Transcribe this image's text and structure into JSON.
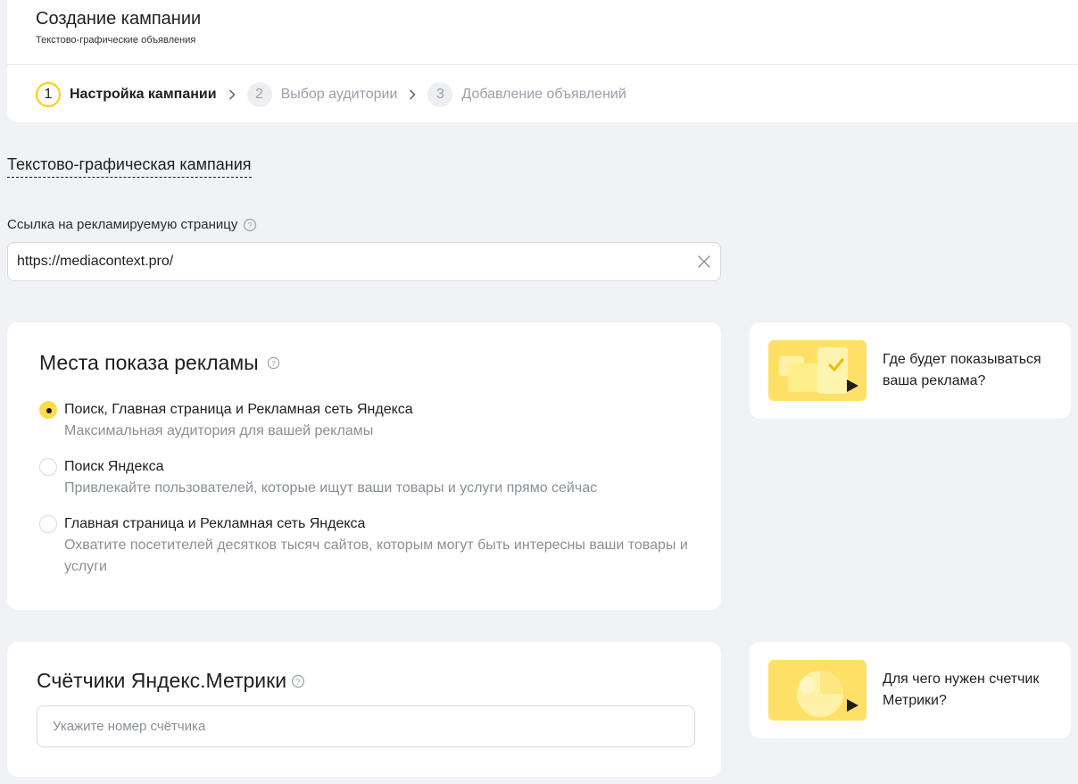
{
  "header": {
    "title": "Создание кампании",
    "subtitle": "Текстово-графические объявления"
  },
  "steps": [
    {
      "number": "1",
      "label": "Настройка кампании",
      "active": true
    },
    {
      "number": "2",
      "label": "Выбор аудитории",
      "active": false
    },
    {
      "number": "3",
      "label": "Добавление объявлений",
      "active": false
    }
  ],
  "campaign_type": "Текстово-графическая кампания",
  "url_field": {
    "label": "Ссылка на рекламируемую страницу",
    "value": "https://mediacontext.pro/"
  },
  "placements": {
    "title": "Места показа рекламы",
    "options": [
      {
        "title": "Поиск, Главная страница и Рекламная сеть Яндекса",
        "description": "Максимальная аудитория для вашей рекламы",
        "selected": true
      },
      {
        "title": "Поиск Яндекса",
        "description": "Привлекайте пользователей, которые ищут ваши товары и услуги прямо сейчас",
        "selected": false
      },
      {
        "title": "Главная страница и Рекламная сеть Яндекса",
        "description": "Охватите посетителей десятков тысяч сайтов, которым могут быть интересны ваши товары и услуги",
        "selected": false
      }
    ]
  },
  "metrica": {
    "title": "Счётчики Яндекс.Метрики",
    "placeholder": "Укажите номер счётчика"
  },
  "help_cards": [
    {
      "text": "Где будет показываться ваша реклама?"
    },
    {
      "text": "Для чего нужен счетчик Метрики?"
    }
  ],
  "colors": {
    "accent": "#ffdb4d",
    "step_ring": "#ffcc00",
    "background": "#f0f2f6",
    "muted_text": "#8a8f97"
  }
}
